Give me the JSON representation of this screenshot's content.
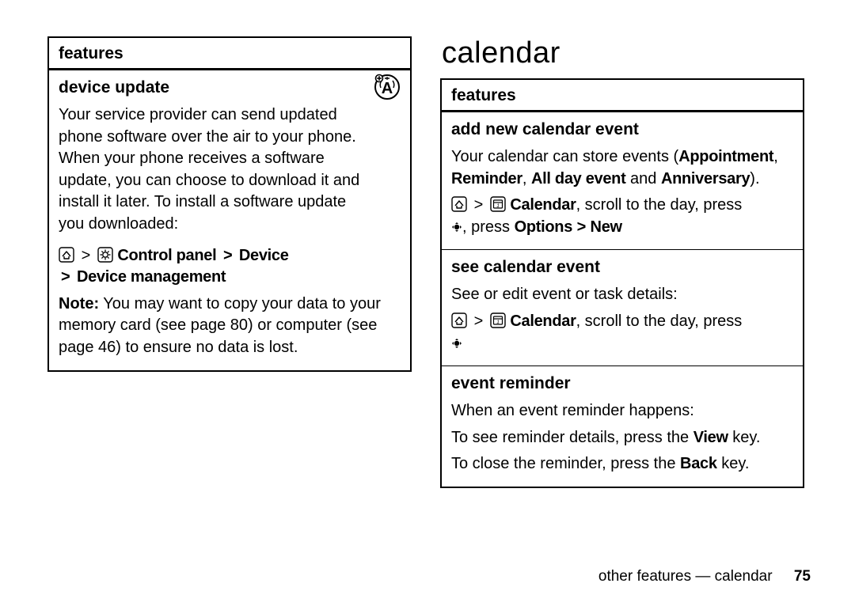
{
  "left": {
    "header": "features",
    "device_update": {
      "title": "device update",
      "desc": "Your service provider can send updated phone software over the air to your phone. When your phone receives a software update, you can choose to download it and install it later. To install a software update you downloaded:",
      "nav1": "Control panel",
      "nav2": "Device",
      "nav3": "Device management",
      "note_prefix": "Note:",
      "note_rest": " You may want to copy your data to your memory card (see page 80) or computer (see page 46) to ensure no data is lost."
    }
  },
  "right": {
    "heading": "calendar",
    "header": "features",
    "add_event": {
      "title": "add new calendar event",
      "line1_a": "Your calendar can store events (",
      "types": {
        "a": "Appointment",
        "b": "Reminder",
        "c": "All day event",
        "d": "Anniversary"
      },
      "line1_b": " and ",
      "line1_c": ").",
      "nav_cal": "Calendar",
      "line2_rest": ", scroll to the day, press ",
      "line3_a": ", press ",
      "options": "Options",
      "new": "New"
    },
    "see_event": {
      "title": "see calendar event",
      "desc": "See or edit event or task details:",
      "nav_cal": "Calendar",
      "rest": ", scroll to the day, press "
    },
    "reminder": {
      "title": "event reminder",
      "l1": "When an event reminder happens:",
      "l2a": "To see reminder details, press the ",
      "view": "View",
      "l2b": " key.",
      "l3a": "To close the reminder, press the ",
      "back": "Back",
      "l3b": " key."
    }
  },
  "footer": {
    "text": "other features — calendar",
    "page": "75"
  }
}
